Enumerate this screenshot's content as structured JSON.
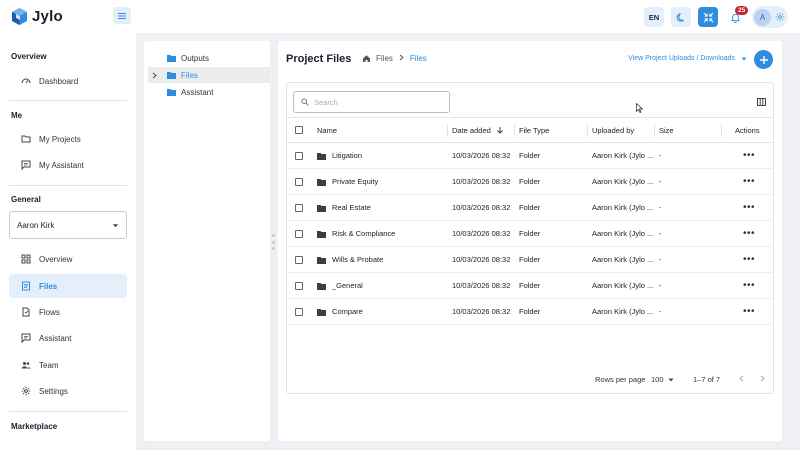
{
  "app": {
    "brand": "Jylo",
    "accent": "#2f8cde",
    "notification_badge_color": "#c1272d"
  },
  "topbar": {
    "language": "EN",
    "notification_count": "25",
    "avatar_initial": "A",
    "icons": [
      "menu-icon",
      "moon-icon",
      "collapse-icon",
      "bell-icon",
      "gear-icon"
    ]
  },
  "sidebar": {
    "sections": {
      "overview": "Overview",
      "me": "Me",
      "general": "General",
      "marketplace": "Marketplace"
    },
    "dashboard": "Dashboard",
    "my_projects": "My Projects",
    "my_assistant": "My Assistant",
    "selected_user": "Aaron Kirk",
    "items": [
      {
        "label": "Overview",
        "icon": "grid-icon"
      },
      {
        "label": "Files",
        "icon": "document-icon",
        "active": true
      },
      {
        "label": "Flows",
        "icon": "flow-icon"
      },
      {
        "label": "Assistant",
        "icon": "chat-icon"
      },
      {
        "label": "Team",
        "icon": "team-icon"
      },
      {
        "label": "Settings",
        "icon": "gear-icon"
      }
    ]
  },
  "tree": {
    "items": [
      {
        "label": "Outputs"
      },
      {
        "label": "Files",
        "active": true
      },
      {
        "label": "Assistant"
      }
    ]
  },
  "main": {
    "title": "Project Files",
    "breadcrumb": [
      "Files",
      "Files"
    ],
    "view_uploads": "View Project Uploads / Downloads",
    "search_placeholder": "Search",
    "columns": {
      "name": "Name",
      "date_added": "Date added",
      "file_type": "File Type",
      "uploaded_by": "Uploaded by",
      "size": "Size",
      "actions": "Actions"
    },
    "rows": [
      {
        "name": "Litigation",
        "date": "10/03/2026 08:32",
        "type": "Folder",
        "uploaded_by": "Aaron Kirk (Jylo ...",
        "size": "-",
        "actions": "•••"
      },
      {
        "name": "Private Equity",
        "date": "10/03/2026 08:32",
        "type": "Folder",
        "uploaded_by": "Aaron Kirk (Jylo ...",
        "size": "-",
        "actions": "•••"
      },
      {
        "name": "Real Estate",
        "date": "10/03/2026 08:32",
        "type": "Folder",
        "uploaded_by": "Aaron Kirk (Jylo ...",
        "size": "-",
        "actions": "•••"
      },
      {
        "name": "Risk & Compliance",
        "date": "10/03/2026 08:32",
        "type": "Folder",
        "uploaded_by": "Aaron Kirk (Jylo ...",
        "size": "-",
        "actions": "•••"
      },
      {
        "name": "Wills & Probate",
        "date": "10/03/2026 08:32",
        "type": "Folder",
        "uploaded_by": "Aaron Kirk (Jylo ...",
        "size": "-",
        "actions": "•••"
      },
      {
        "name": "_General",
        "date": "10/03/2026 08:32",
        "type": "Folder",
        "uploaded_by": "Aaron Kirk (Jylo ...",
        "size": "-",
        "actions": "•••"
      },
      {
        "name": "Compare",
        "date": "10/03/2026 08:32",
        "type": "Folder",
        "uploaded_by": "Aaron Kirk (Jylo ...",
        "size": "-",
        "actions": "•••"
      }
    ],
    "pagination": {
      "rows_per_page_label": "Rows per page",
      "rows_per_page": "100",
      "range": "1–7 of 7"
    }
  }
}
